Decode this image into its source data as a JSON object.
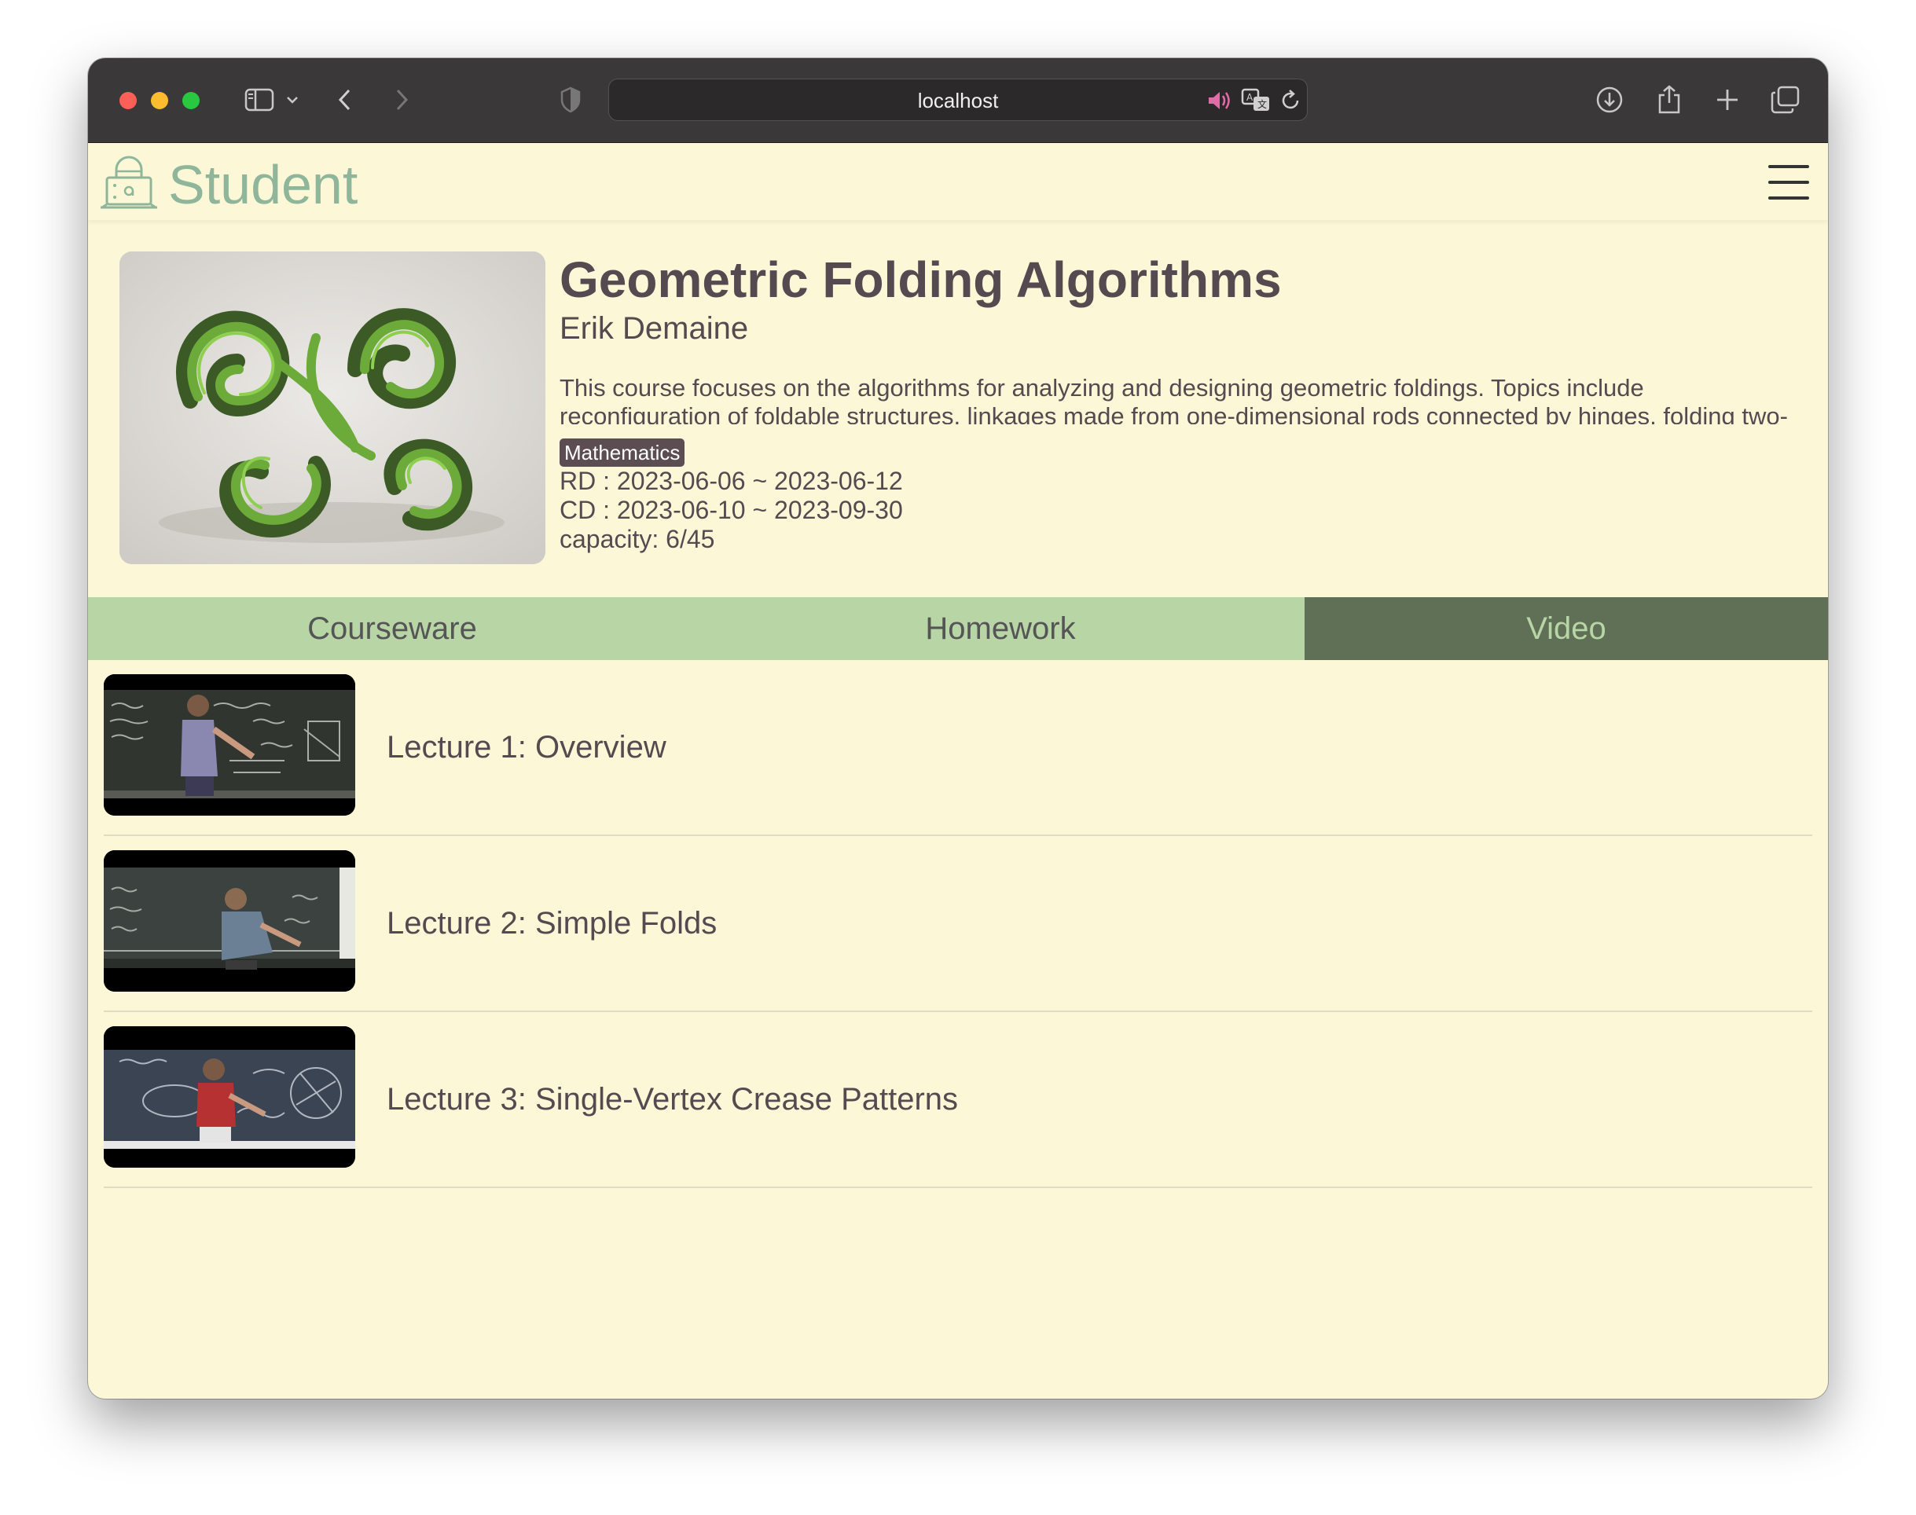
{
  "browser": {
    "url": "localhost"
  },
  "app": {
    "name": "Student"
  },
  "course": {
    "title": "Geometric Folding Algorithms",
    "teacher": "Erik Demaine",
    "description": "This course focuses on the algorithms for analyzing and designing geometric foldings. Topics include reconfiguration of foldable structures, linkages made from one-dimensional rods connected by hinges, folding two-dimensional paper (origami), and unfolding and folding three-dimensional polyhedra.",
    "tag": "Mathematics",
    "rd": "RD : 2023-06-06 ~ 2023-06-12",
    "cd": "CD : 2023-06-10 ~ 2023-09-30",
    "capacity": "capacity: 6/45"
  },
  "tabs": [
    {
      "label": "Courseware",
      "active": false
    },
    {
      "label": "Homework",
      "active": false
    },
    {
      "label": "Video",
      "active": true
    }
  ],
  "videos": [
    {
      "title": "Lecture 1: Overview"
    },
    {
      "title": "Lecture 2: Simple Folds"
    },
    {
      "title": "Lecture 3: Single-Vertex Crease Patterns"
    }
  ],
  "colors": {
    "page_bg": "#fcf8d7",
    "brand": "#8fb69a",
    "tab_bg": "#b8d5a6",
    "tab_active_bg": "#5f7057",
    "text": "#554a50"
  },
  "icons": [
    "sidebar-icon",
    "chevron-down-icon",
    "back-icon",
    "forward-icon",
    "shield-icon",
    "speaker-icon",
    "translate-icon",
    "reload-icon",
    "download-icon",
    "share-icon",
    "new-tab-icon",
    "tabs-overview-icon",
    "lock-icon",
    "hamburger-menu-icon"
  ]
}
